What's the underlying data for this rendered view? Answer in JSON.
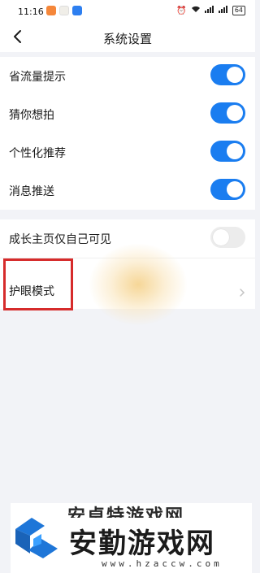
{
  "status_bar": {
    "time": "11:16",
    "battery": "64"
  },
  "header": {
    "title": "系统设置"
  },
  "settings_group1": [
    {
      "label": "省流量提示",
      "enabled": true
    },
    {
      "label": "猜你想拍",
      "enabled": true
    },
    {
      "label": "个性化推荐",
      "enabled": true
    },
    {
      "label": "消息推送",
      "enabled": true
    }
  ],
  "settings_group2": {
    "profile_visibility": {
      "label": "成长主页仅自己可见",
      "enabled": false
    },
    "eye_mode": {
      "label": "护眼模式"
    }
  },
  "watermark": {
    "faint_text": "安卓特游戏网",
    "title": "安勤游戏网",
    "url": "www.hzaccw.com"
  },
  "colors": {
    "accent": "#1a7df0",
    "highlight": "#d62b2b"
  }
}
